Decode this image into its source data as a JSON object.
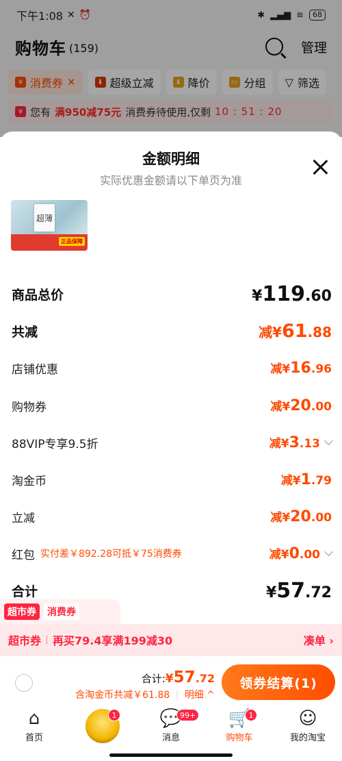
{
  "status_bar": {
    "time": "下午1:08",
    "battery": "68"
  },
  "cart_header": {
    "title": "购物车",
    "count": "(159)",
    "manage": "管理"
  },
  "filters": [
    {
      "icon": "¥",
      "label": "消费券",
      "active": true
    },
    {
      "label": "超级立减"
    },
    {
      "label": "降价"
    },
    {
      "label": "分组"
    },
    {
      "label": "筛选"
    }
  ],
  "notice": {
    "pre": "您有",
    "highlight": "满950减75元",
    "post": "消费券待使用,仅剩",
    "timer": "10 : 51 : 20"
  },
  "sheet": {
    "title": "金额明细",
    "subtitle": "实际优惠金额请以下单页为准",
    "thumb_text": "超薄",
    "thumb_tag": "正品保障",
    "rows": [
      {
        "label": "商品总价",
        "pre": "¥",
        "int": "119",
        "dec": ".60"
      },
      {
        "label": "共减",
        "pre": "减¥",
        "int": "61",
        "dec": ".88"
      },
      {
        "label": "店铺优惠",
        "pre": "减¥",
        "int": "16",
        "dec": ".96"
      },
      {
        "label": "购物券",
        "pre": "减¥",
        "int": "20",
        "dec": ".00"
      },
      {
        "label": "88VIP专享9.5折",
        "pre": "减¥",
        "int": "3",
        "dec": ".13"
      },
      {
        "label": "淘金币",
        "pre": "减¥",
        "int": "1",
        "dec": ".79"
      },
      {
        "label": "立减",
        "pre": "减¥",
        "int": "20",
        "dec": ".00"
      },
      {
        "label": "红包",
        "hint": "实付差￥892.28可抵￥75消费券",
        "pre": "减¥",
        "int": "0",
        "dec": ".00"
      },
      {
        "label": "合计",
        "pre": "¥",
        "int": "57",
        "dec": ".72"
      }
    ]
  },
  "coupon": {
    "tab_active": "超市券",
    "tab_inactive": "消费券",
    "bar_label": "超市券",
    "bar_text": "再买79.4享满199减30",
    "bar_action": "凑单"
  },
  "checkout": {
    "total_label": "合计:",
    "total_pre": "¥",
    "total_int": "57",
    "total_dec": ".72",
    "sub_text": "含淘金币共减￥61.88",
    "detail": "明细",
    "button": "领券结算(1)"
  },
  "tabbar": [
    {
      "label": "首页",
      "icon": "home-icon"
    },
    {
      "label": "",
      "icon": "avatar",
      "badge": "1"
    },
    {
      "label": "消息",
      "icon": "message-icon",
      "badge": "99+"
    },
    {
      "label": "购物车",
      "icon": "cart-icon",
      "badge": "1",
      "active": true
    },
    {
      "label": "我的淘宝",
      "icon": "profile-icon"
    }
  ],
  "colors": {
    "accent": "#ff4a00",
    "coupon_red": "#ff2442",
    "muted": "#888888"
  }
}
